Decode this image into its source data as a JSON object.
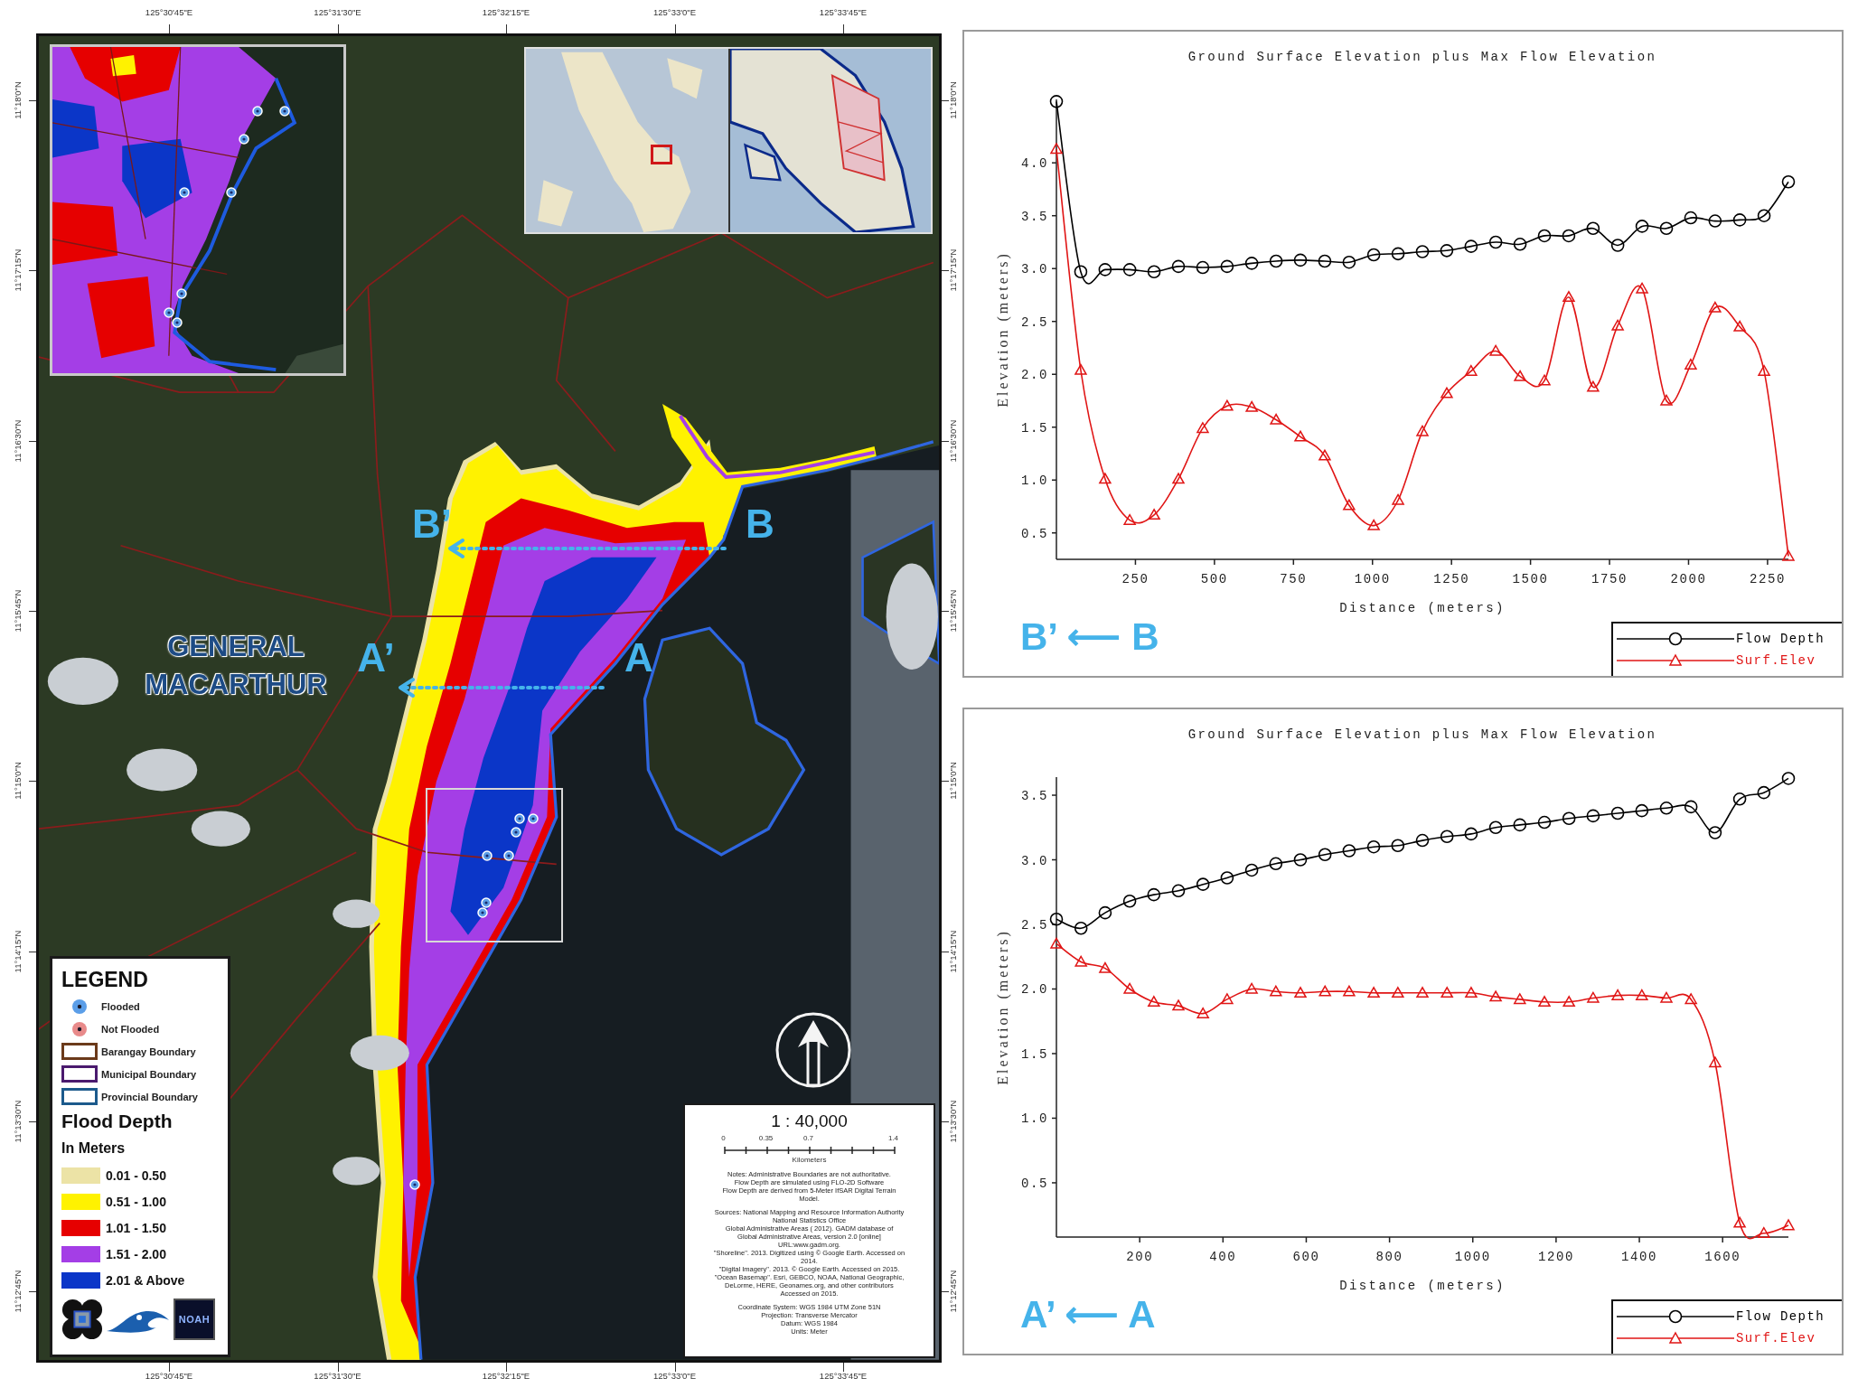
{
  "map": {
    "coordinates": {
      "top": [
        "125°30'45\"E",
        "125°31'30\"E",
        "125°32'15\"E",
        "125°33'0\"E",
        "125°33'45\"E"
      ],
      "left": [
        "11°18'0\"N",
        "11°17'15\"N",
        "11°16'30\"N",
        "11°15'45\"N",
        "11°15'0\"N",
        "11°14'15\"N",
        "11°13'30\"N",
        "11°12'45\"N"
      ],
      "right": [
        "11°18'0\"N",
        "11°17'15\"N",
        "11°16'30\"N",
        "11°15'45\"N",
        "11°15'0\"N",
        "11°14'15\"N",
        "11°13'30\"N",
        "11°12'45\"N"
      ],
      "bottom": [
        "125°30'45\"E",
        "125°31'30\"E",
        "125°32'15\"E",
        "125°33'0\"E",
        "125°33'45\"E"
      ]
    },
    "place_label": [
      "GENERAL",
      "MACARTHUR"
    ],
    "cross_sections": [
      {
        "start": "B",
        "end": "B’"
      },
      {
        "start": "A",
        "end": "A’"
      }
    ],
    "legend": {
      "title": "LEGEND",
      "symbols": [
        {
          "kind": "point",
          "label": "Flooded",
          "color": "#5b9ee8"
        },
        {
          "kind": "point",
          "label": "Not Flooded",
          "color": "#e88a8a"
        },
        {
          "kind": "outline",
          "label": "Barangay Boundary",
          "color": "#6b3a1a"
        },
        {
          "kind": "outline",
          "label": "Municipal Boundary",
          "color": "#4a1a6e"
        },
        {
          "kind": "outline",
          "label": "Provincial Boundary",
          "color": "#1c5a8c"
        }
      ],
      "depth_title": "Flood Depth",
      "depth_unit": "In Meters",
      "depth_classes": [
        {
          "label": "0.01 - 0.50",
          "color": "#ece3a6"
        },
        {
          "label": "0.51 - 1.00",
          "color": "#fff200"
        },
        {
          "label": "1.01 - 1.50",
          "color": "#e60000"
        },
        {
          "label": "1.51 - 2.00",
          "color": "#a43ee6"
        },
        {
          "label": "2.01 & Above",
          "color": "#0b36c8"
        }
      ],
      "logo_text": "NOAH"
    },
    "scale": {
      "ratio": "1 : 40,000",
      "ticks": [
        "0",
        "0.35",
        "0.7",
        "1.4"
      ],
      "unit": "Kilometers",
      "notes": [
        [
          "Notes: Administrative Boundaries are not authoritative.",
          "Flow Depth are simulated using FLO-2D Software",
          "Flow Depth are derived from 5-Meter IfSAR Digital Terrain",
          "Model."
        ],
        [
          "Sources: National Mapping and Resource Information Authority",
          "National Statistics Office",
          "Global Administrative Areas ( 2012). GADM database of",
          "Global Administrative Areas, version 2.0 [online]",
          "URL:www.gadm.org.",
          "\"Shoreline\". 2013. Digitized using © Google Earth. Accessed on",
          "2014.",
          "\"Digital Imagery\". 2013. © Google Earth. Accessed on 2015.",
          "\"Ocean Basemap\". Esri, GEBCO, NOAA, National Geographic,",
          "DeLorme, HERE, Geonames.org, and other contributors",
          "Accessed on 2015."
        ],
        [
          "Coordinate System: WGS 1984 UTM Zone 51N",
          "Projection: Transverse Mercator",
          "Datum: WGS 1984",
          "Units: Meter"
        ]
      ]
    }
  },
  "profiles": [
    {
      "section_label": "B’ ⟵ B",
      "chart_data": {
        "type": "line",
        "title": "Ground Surface Elevation plus Max Flow Elevation",
        "xlabel": "Distance (meters)",
        "ylabel": "Elevation (meters)",
        "x": [
          0,
          77,
          154,
          232,
          309,
          386,
          463,
          540,
          618,
          695,
          772,
          849,
          926,
          1004,
          1081,
          1158,
          1235,
          1312,
          1390,
          1467,
          1544,
          1621,
          1698,
          1776,
          1853,
          1930,
          2007,
          2084,
          2162,
          2239,
          2316
        ],
        "series": [
          {
            "name": "Flow Depth",
            "color": "#000000",
            "marker": "circle",
            "values": [
              4.58,
              2.97,
              2.99,
              2.99,
              2.97,
              3.02,
              3.01,
              3.02,
              3.05,
              3.07,
              3.08,
              3.07,
              3.06,
              3.13,
              3.14,
              3.16,
              3.17,
              3.21,
              3.25,
              3.23,
              3.31,
              3.31,
              3.38,
              3.22,
              3.4,
              3.38,
              3.48,
              3.45,
              3.46,
              3.5,
              3.82
            ]
          },
          {
            "name": "Surf.Elev",
            "color": "#e01515",
            "marker": "triangle",
            "values": [
              4.13,
              2.04,
              1.01,
              0.62,
              0.67,
              1.01,
              1.49,
              1.7,
              1.69,
              1.57,
              1.41,
              1.23,
              0.76,
              0.57,
              0.81,
              1.46,
              1.82,
              2.03,
              2.22,
              1.98,
              1.94,
              2.73,
              1.88,
              2.46,
              2.81,
              1.75,
              2.09,
              2.63,
              2.45,
              2.03,
              0.28
            ]
          }
        ],
        "xlim": [
          0,
          2316
        ],
        "ylim": [
          0.25,
          4.6
        ],
        "xticks": [
          250,
          500,
          750,
          1000,
          1250,
          1500,
          1750,
          2000,
          2250
        ],
        "yticks": [
          {
            "value": 0.5,
            "label": "0.5"
          },
          {
            "value": 1,
            "label": "1.0"
          },
          {
            "value": 1.5,
            "label": "1.5"
          },
          {
            "value": 2,
            "label": "2.0"
          },
          {
            "value": 2.5,
            "label": "2.5"
          },
          {
            "value": 3,
            "label": "3.0"
          },
          {
            "value": 3.5,
            "label": "3.5"
          },
          {
            "value": 4,
            "label": "4.0"
          }
        ]
      }
    },
    {
      "section_label": "A’ ⟵ A",
      "chart_data": {
        "type": "line",
        "title": "Ground Surface Elevation plus Max Flow Elevation",
        "xlabel": "Distance (meters)",
        "ylabel": "Elevation (meters)",
        "x": [
          0,
          59,
          117,
          176,
          234,
          293,
          352,
          410,
          469,
          527,
          586,
          645,
          703,
          762,
          820,
          879,
          938,
          996,
          1055,
          1113,
          1172,
          1231,
          1289,
          1348,
          1406,
          1465,
          1524,
          1582,
          1641,
          1699,
          1758
        ],
        "series": [
          {
            "name": "Flow Depth",
            "color": "#000000",
            "marker": "circle",
            "values": [
              2.54,
              2.47,
              2.59,
              2.68,
              2.73,
              2.76,
              2.81,
              2.86,
              2.92,
              2.97,
              3.0,
              3.04,
              3.07,
              3.1,
              3.11,
              3.15,
              3.18,
              3.2,
              3.25,
              3.27,
              3.29,
              3.32,
              3.34,
              3.36,
              3.38,
              3.4,
              3.41,
              3.21,
              3.47,
              3.52,
              3.63
            ]
          },
          {
            "name": "Surf.Elev",
            "color": "#e01515",
            "marker": "triangle",
            "values": [
              2.35,
              2.21,
              2.16,
              2.0,
              1.9,
              1.87,
              1.81,
              1.92,
              2.0,
              1.98,
              1.97,
              1.98,
              1.98,
              1.97,
              1.97,
              1.97,
              1.97,
              1.97,
              1.94,
              1.92,
              1.9,
              1.9,
              1.93,
              1.95,
              1.95,
              1.93,
              1.92,
              1.43,
              0.19,
              0.11,
              0.17
            ]
          }
        ],
        "xlim": [
          0,
          1758
        ],
        "ylim": [
          0.08,
          3.64
        ],
        "xticks": [
          200,
          400,
          600,
          800,
          1000,
          1200,
          1400,
          1600
        ],
        "yticks": [
          {
            "value": 0.5,
            "label": "0.5"
          },
          {
            "value": 1,
            "label": "1.0"
          },
          {
            "value": 1.5,
            "label": "1.5"
          },
          {
            "value": 2,
            "label": "2.0"
          },
          {
            "value": 2.5,
            "label": "2.5"
          },
          {
            "value": 3,
            "label": "3.0"
          },
          {
            "value": 3.5,
            "label": "3.5"
          }
        ]
      }
    }
  ]
}
